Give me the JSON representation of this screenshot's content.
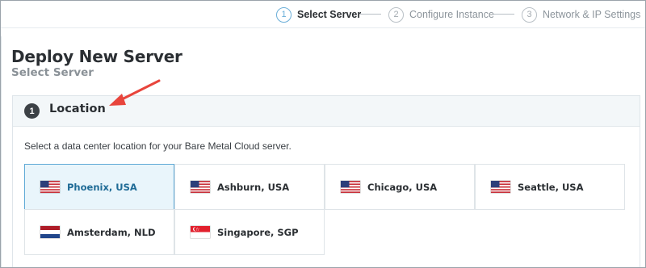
{
  "stepper": {
    "steps": [
      {
        "number": "1",
        "label": "Select Server"
      },
      {
        "number": "2",
        "label": "Configure Instance"
      },
      {
        "number": "3",
        "label": "Network & IP Settings"
      }
    ]
  },
  "page": {
    "title": "Deploy New Server",
    "subtitle": "Select Server"
  },
  "location_section": {
    "number": "1",
    "title": "Location",
    "description": "Select a data center location for your Bare Metal Cloud server.",
    "locations": [
      {
        "label": "Phoenix, USA",
        "flag": "us-flag",
        "selected": true
      },
      {
        "label": "Ashburn, USA",
        "flag": "us-flag",
        "selected": false
      },
      {
        "label": "Chicago, USA",
        "flag": "us-flag",
        "selected": false
      },
      {
        "label": "Seattle, USA",
        "flag": "us-flag",
        "selected": false
      },
      {
        "label": "Amsterdam, NLD",
        "flag": "nl-flag",
        "selected": false
      },
      {
        "label": "Singapore, SGP",
        "flag": "sg-flag",
        "selected": false
      }
    ]
  },
  "colors": {
    "accent": "#5fa9d6",
    "selected_bg": "#e9f5fb",
    "annotation_arrow": "#e8453c"
  }
}
